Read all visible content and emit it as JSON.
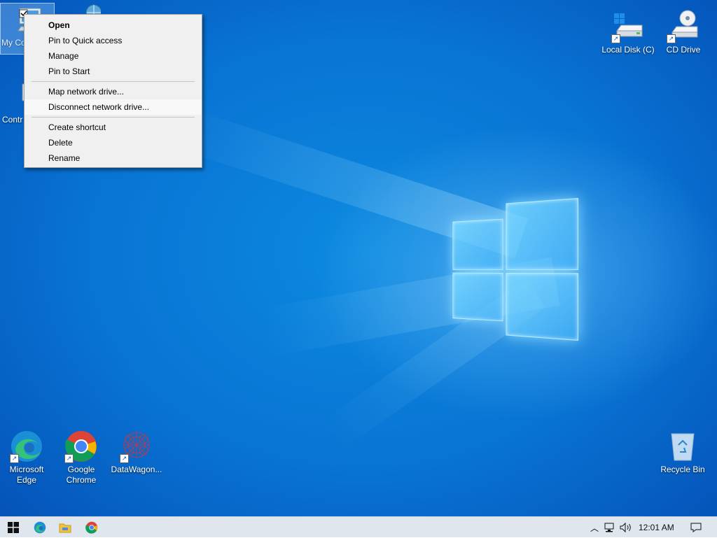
{
  "desktop": {
    "icons_left": [
      {
        "label": "My Co",
        "icon": "computer-icon"
      },
      {
        "label": "Contr",
        "icon": "control-panel-icon"
      }
    ],
    "icons_top_right": [
      {
        "label": "Local Disk (C)",
        "icon": "hard-drive-icon"
      },
      {
        "label": "CD Drive",
        "icon": "cd-drive-icon"
      }
    ],
    "icons_bottom": [
      {
        "label": "Microsoft Edge",
        "icon": "edge-icon"
      },
      {
        "label": "Google Chrome",
        "icon": "chrome-icon"
      },
      {
        "label": "DataWagon...",
        "icon": "datawagon-icon"
      }
    ],
    "recycle_bin": {
      "label": "Recycle Bin",
      "icon": "recycle-bin-icon"
    }
  },
  "context_menu": {
    "group1": [
      "Open",
      "Pin to Quick access",
      "Manage",
      "Pin to Start"
    ],
    "group2": [
      "Map network drive...",
      "Disconnect network drive..."
    ],
    "group3": [
      "Create shortcut",
      "Delete",
      "Rename"
    ]
  },
  "taskbar": {
    "pinned": [
      "start-button",
      "edge-icon",
      "file-explorer-icon",
      "chrome-icon"
    ],
    "clock": "12:01 AM"
  },
  "colors": {
    "desktop_blue": "#0873d3",
    "menu_bg": "#f0f0f0",
    "taskbar_bg": "#dfe6ee"
  }
}
